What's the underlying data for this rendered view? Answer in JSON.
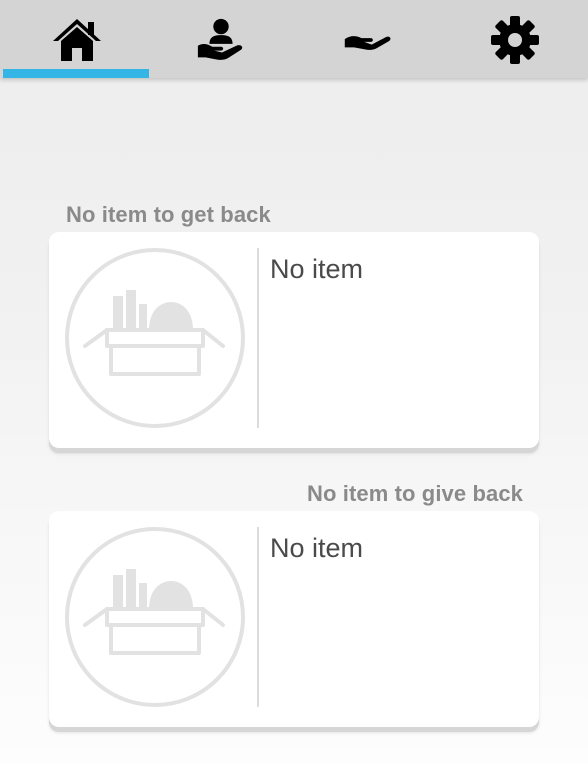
{
  "tabs": [
    {
      "icon": "home-icon",
      "selected": true
    },
    {
      "icon": "receive-person-icon",
      "selected": false
    },
    {
      "icon": "give-hand-icon",
      "selected": false
    },
    {
      "icon": "gear-icon",
      "selected": false
    }
  ],
  "colors": {
    "tab_bar": "#d4d4d4",
    "tab_indicator": "#33b5e5",
    "section_title": "#8a8a8a",
    "card_text": "#4a4a4a",
    "placeholder_icon": "#e2e2e2"
  },
  "sections": {
    "get_back": {
      "title": "No item to get back",
      "item_text": "No item",
      "placeholder_icon": "empty-box-icon"
    },
    "give_back": {
      "title": "No item to give back",
      "item_text": "No item",
      "placeholder_icon": "empty-box-icon"
    }
  }
}
